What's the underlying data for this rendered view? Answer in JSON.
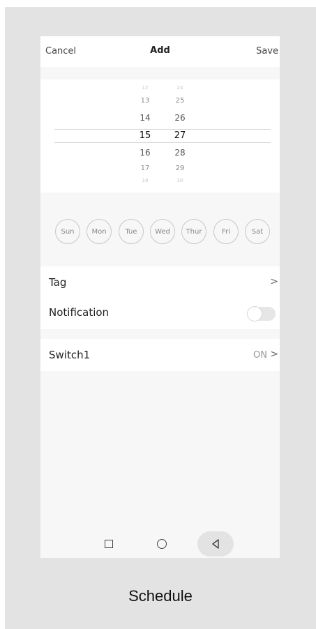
{
  "header": {
    "cancel": "Cancel",
    "title": "Add",
    "save": "Save"
  },
  "picker": {
    "hours": [
      "12",
      "13",
      "14",
      "15",
      "16",
      "17",
      "18"
    ],
    "minutes": [
      "24",
      "25",
      "26",
      "27",
      "28",
      "29",
      "30"
    ],
    "selected_hour": "15",
    "selected_minute": "27"
  },
  "days": [
    "Sun",
    "Mon",
    "Tue",
    "Wed",
    "Thur",
    "Fri",
    "Sat"
  ],
  "tag": {
    "label": "Tag"
  },
  "notification": {
    "label": "Notification",
    "enabled": false
  },
  "switch1": {
    "label": "Switch1",
    "value": "ON"
  },
  "caption": "Schedule",
  "colors": {
    "frame": "#e3e3e3",
    "background": "#f6f7f6",
    "toggle_off": "#e6e6e6"
  }
}
